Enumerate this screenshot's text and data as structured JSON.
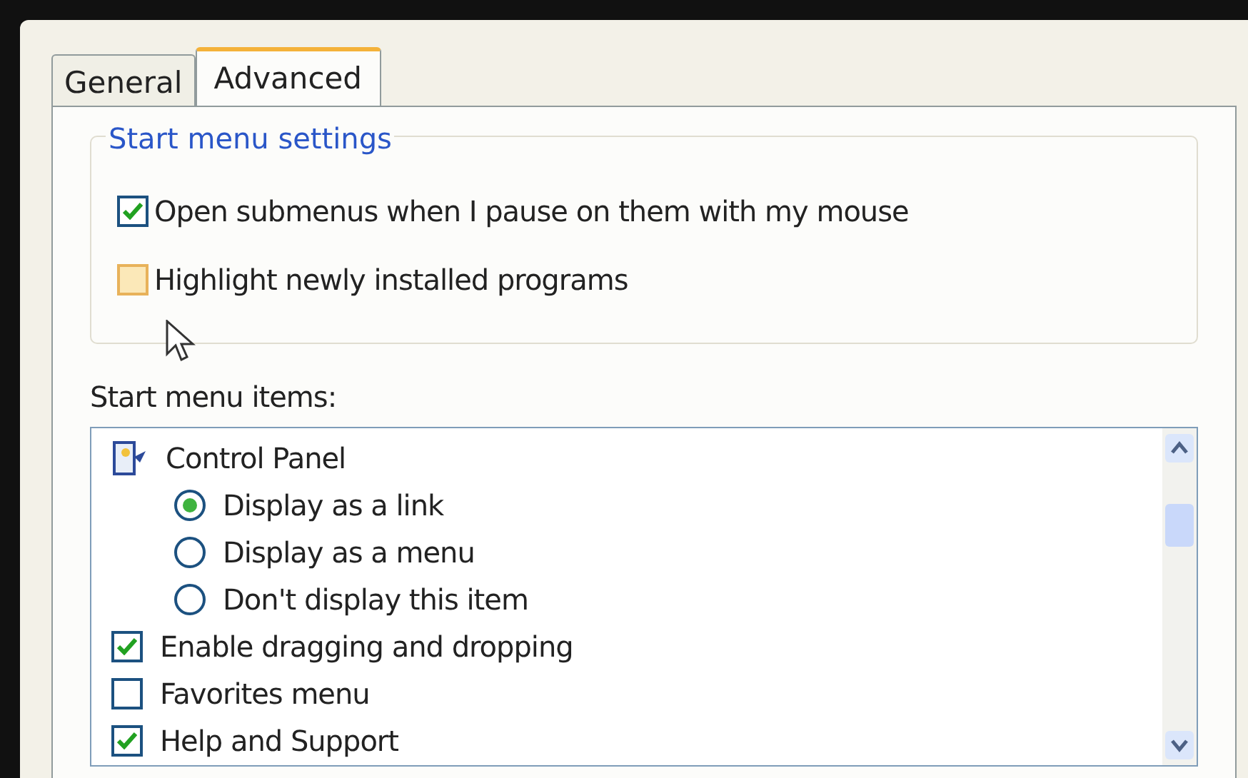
{
  "tabs": [
    {
      "label": "General",
      "selected": false
    },
    {
      "label": "Advanced",
      "selected": true
    }
  ],
  "settings_group": {
    "title": "Start menu settings",
    "options": [
      {
        "label": "Open submenus when I pause on them with my mouse",
        "checked": true
      },
      {
        "label": "Highlight newly installed programs",
        "checked": false
      }
    ]
  },
  "items_label": "Start menu items:",
  "items": [
    {
      "kind": "folder",
      "label": "Control Panel",
      "children": [
        {
          "kind": "radio",
          "label": "Display as a link",
          "selected": true
        },
        {
          "kind": "radio",
          "label": "Display as a menu",
          "selected": false
        },
        {
          "kind": "radio",
          "label": "Don't display this item",
          "selected": false
        }
      ]
    },
    {
      "kind": "checkbox",
      "label": "Enable dragging and dropping",
      "checked": true
    },
    {
      "kind": "checkbox",
      "label": "Favorites menu",
      "checked": false
    },
    {
      "kind": "checkbox",
      "label": "Help and Support",
      "checked": true
    }
  ]
}
